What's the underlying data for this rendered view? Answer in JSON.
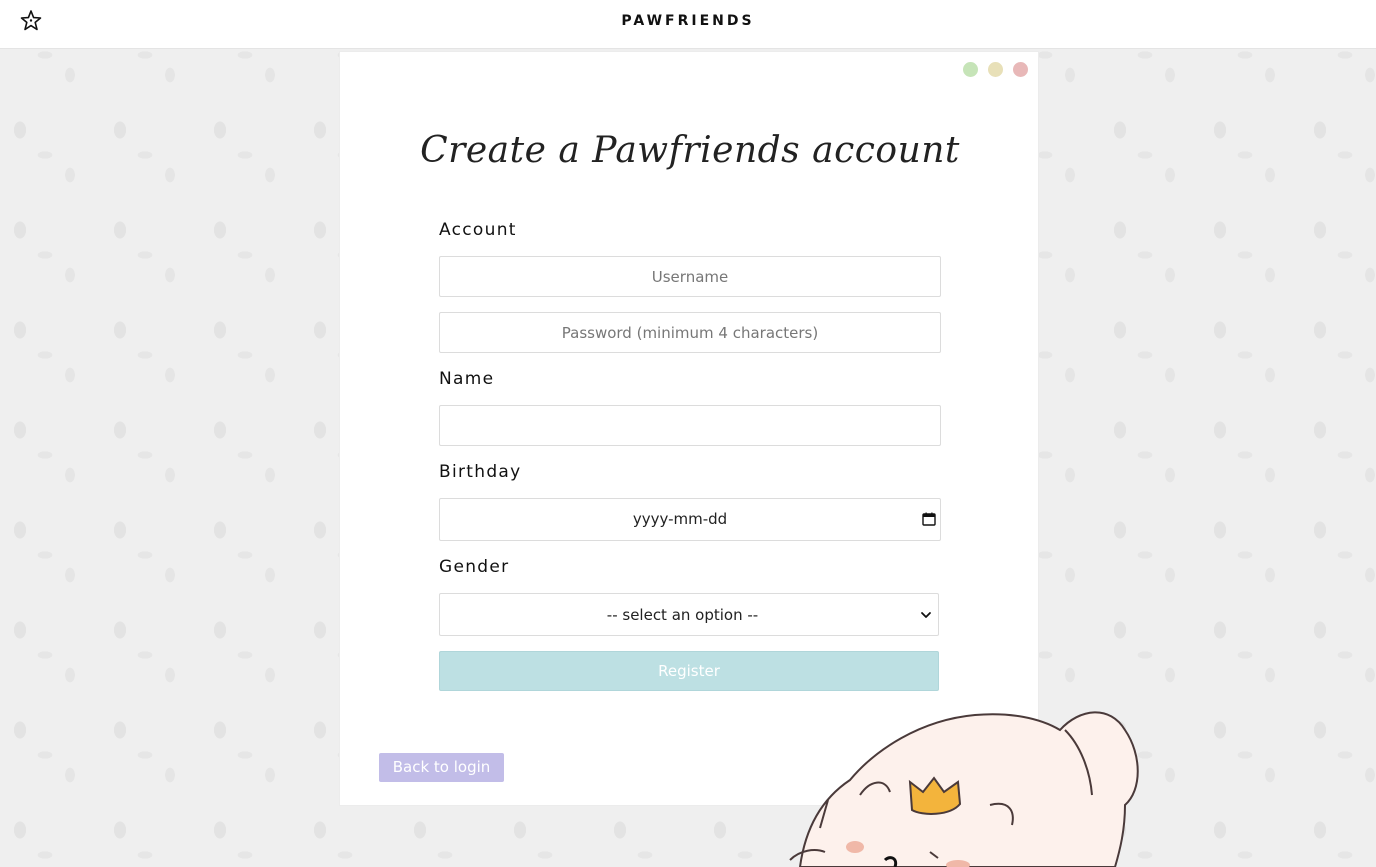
{
  "header": {
    "brand": "PAWFRIENDS",
    "logo_icon": "star-icon"
  },
  "window_dots": {
    "colors": [
      "#c6e4b8",
      "#e8e0b8",
      "#e8b8b8"
    ]
  },
  "form": {
    "title": "Create a Pawfriends account",
    "account_label": "Account",
    "username_placeholder": "Username",
    "password_placeholder": "Password (minimum 4 characters)",
    "name_label": "Name",
    "name_value": "",
    "birthday_label": "Birthday",
    "birthday_value": "yyyy-mm-dd",
    "gender_label": "Gender",
    "gender_value": "-- select an option --",
    "register_label": "Register",
    "back_label": "Back to login"
  },
  "colors": {
    "register_button": "#bde0e3",
    "back_button": "#c2bde8",
    "background": "#efefef"
  },
  "decoration": {
    "mascot": "sleeping-cat-with-crown"
  }
}
